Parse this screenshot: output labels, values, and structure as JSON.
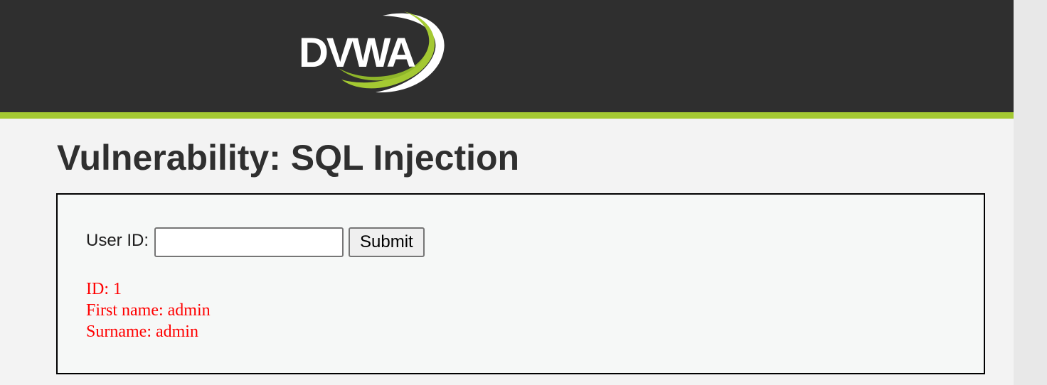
{
  "header": {
    "logo_text": "DVWA",
    "colors": {
      "background": "#2f2f2f",
      "accent": "#a4c932"
    }
  },
  "main": {
    "title": "Vulnerability: SQL Injection",
    "form": {
      "label": "User ID:",
      "input_value": "",
      "submit_label": "Submit"
    },
    "result": {
      "color": "#ff0000",
      "lines": [
        "ID: 1",
        "First name: admin",
        "Surname: admin"
      ]
    }
  }
}
